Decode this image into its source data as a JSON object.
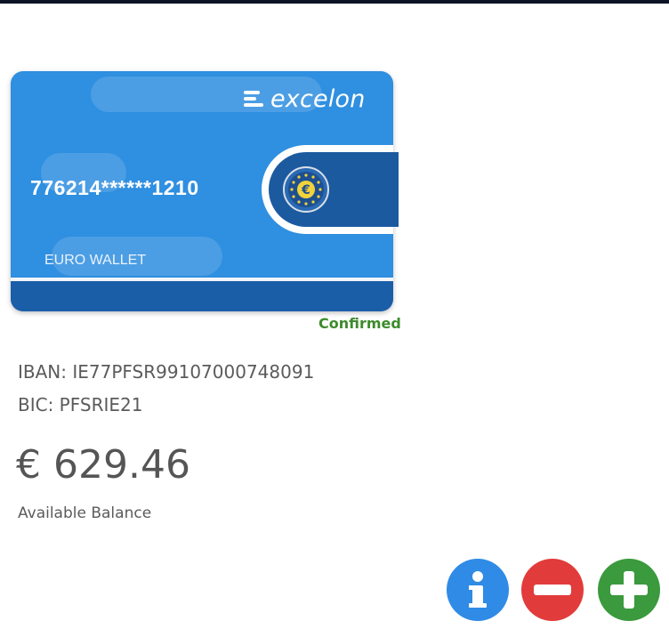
{
  "card": {
    "brand": "excelon",
    "number": "776214******1210",
    "wallet_label": "EURO WALLET",
    "currency_symbol": "€",
    "status": "Confirmed"
  },
  "account": {
    "iban": "IBAN: IE77PFSR99107000748091",
    "bic": "BIC: PFSRIE21"
  },
  "balance": {
    "amount": "€ 629.46",
    "label": "Available Balance"
  },
  "actions": {
    "info_icon": "info-icon",
    "remove_icon": "minus-icon",
    "add_icon": "plus-icon"
  },
  "colors": {
    "card_blue": "#2f8fe0",
    "card_dark": "#1b5ea8",
    "confirmed_green": "#3d8b2c",
    "info_blue": "#2f8be6",
    "remove_red": "#e23b3b",
    "add_green": "#3a9a3d"
  }
}
